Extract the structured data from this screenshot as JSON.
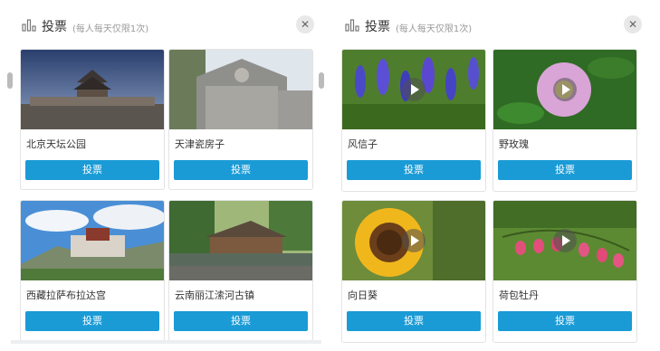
{
  "left_panel": {
    "title": "投票",
    "subtitle": "(每人每天仅限1次)",
    "close_icon": "close-icon",
    "cards": [
      {
        "name": "北京天坛公园",
        "button": "投票",
        "media": "photo"
      },
      {
        "name": "天津瓷房子",
        "button": "投票",
        "media": "photo"
      },
      {
        "name": "西藏拉萨布拉达宫",
        "button": "投票",
        "media": "photo"
      },
      {
        "name": "云南丽江溹河古镇",
        "button": "投票",
        "media": "photo"
      }
    ]
  },
  "right_panel": {
    "title": "投票",
    "subtitle": "(每人每天仅限1次)",
    "close_icon": "close-icon",
    "cards": [
      {
        "name": "风信子",
        "button": "投票",
        "media": "video"
      },
      {
        "name": "野玫瑰",
        "button": "投票",
        "media": "video"
      },
      {
        "name": "向日葵",
        "button": "投票",
        "media": "video"
      },
      {
        "name": "荷包牡丹",
        "button": "投票",
        "media": "video"
      }
    ]
  },
  "colors": {
    "accent": "#1a9bd6",
    "border": "#e3e3e3"
  }
}
